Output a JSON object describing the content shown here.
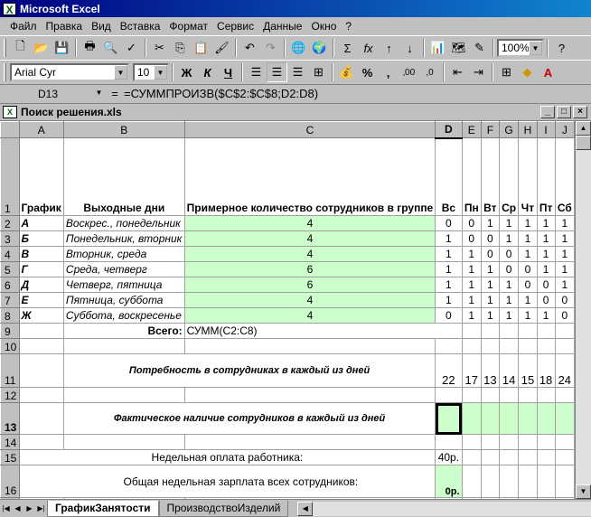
{
  "app": {
    "title": "Microsoft Excel"
  },
  "menu": [
    "Файл",
    "Правка",
    "Вид",
    "Вставка",
    "Формат",
    "Сервис",
    "Данные",
    "Окно",
    "?"
  ],
  "toolbar": {
    "zoom": "100%",
    "font": "Arial Cyr",
    "size": "10",
    "bold": "Ж",
    "italic": "К",
    "underline": "Ч",
    "sum": "Σ",
    "fx": "fx",
    "percent": "%",
    "comma": ",",
    "inc_decimal": "‚00",
    "dec_decimal": ",0"
  },
  "formula_bar": {
    "name": "D13",
    "eq": "=",
    "formula": "=СУММПРОИЗВ($C$2:$C$8;D2:D8)"
  },
  "workbook": {
    "title": "Поиск решения.xls"
  },
  "columns": [
    "A",
    "B",
    "C",
    "D",
    "E",
    "F",
    "G",
    "H",
    "I",
    "J"
  ],
  "header_row": {
    "a": "График",
    "b": "Выходные дни",
    "c": "Примерное количество сотрудников в группе",
    "days": [
      "Вс",
      "Пн",
      "Вт",
      "Ср",
      "Чт",
      "Пт",
      "Сб"
    ]
  },
  "schedules": [
    {
      "row": "2",
      "code": "А",
      "days_off": "Воскрес., понедельник",
      "count": "4",
      "values": [
        "0",
        "0",
        "1",
        "1",
        "1",
        "1",
        "1"
      ]
    },
    {
      "row": "3",
      "code": "Б",
      "days_off": "Понедельник, вторник",
      "count": "4",
      "values": [
        "1",
        "0",
        "0",
        "1",
        "1",
        "1",
        "1"
      ]
    },
    {
      "row": "4",
      "code": "В",
      "days_off": "Вторник, среда",
      "count": "4",
      "values": [
        "1",
        "1",
        "0",
        "0",
        "1",
        "1",
        "1"
      ]
    },
    {
      "row": "5",
      "code": "Г",
      "days_off": "Среда, четверг",
      "count": "6",
      "values": [
        "1",
        "1",
        "1",
        "0",
        "0",
        "1",
        "1"
      ]
    },
    {
      "row": "6",
      "code": "Д",
      "days_off": "Четверг, пятница",
      "count": "6",
      "values": [
        "1",
        "1",
        "1",
        "1",
        "0",
        "0",
        "1"
      ]
    },
    {
      "row": "7",
      "code": "Е",
      "days_off": "Пятница, суббота",
      "count": "4",
      "values": [
        "1",
        "1",
        "1",
        "1",
        "1",
        "0",
        "0"
      ]
    },
    {
      "row": "8",
      "code": "Ж",
      "days_off": "Суббота, воскресенье",
      "count": "4",
      "values": [
        "0",
        "1",
        "1",
        "1",
        "1",
        "1",
        "0"
      ]
    }
  ],
  "row9": {
    "label": "Всего:",
    "formula": "СУММ(C2:C8)"
  },
  "row11": {
    "label": "Потребность в сотрудниках в каждый из дней",
    "values": [
      "22",
      "17",
      "13",
      "14",
      "15",
      "18",
      "24"
    ]
  },
  "row13": {
    "label": "Фактическое наличие сотрудников в каждый из дней"
  },
  "row15": {
    "label": "Недельная оплата работника:",
    "value": "40р."
  },
  "row16": {
    "label": "Общая недельная зарплата всех сотрудников:",
    "value": "0р."
  },
  "sheet_tabs": [
    "ГрафикЗанятости",
    "ПроизводствоИзделий"
  ]
}
